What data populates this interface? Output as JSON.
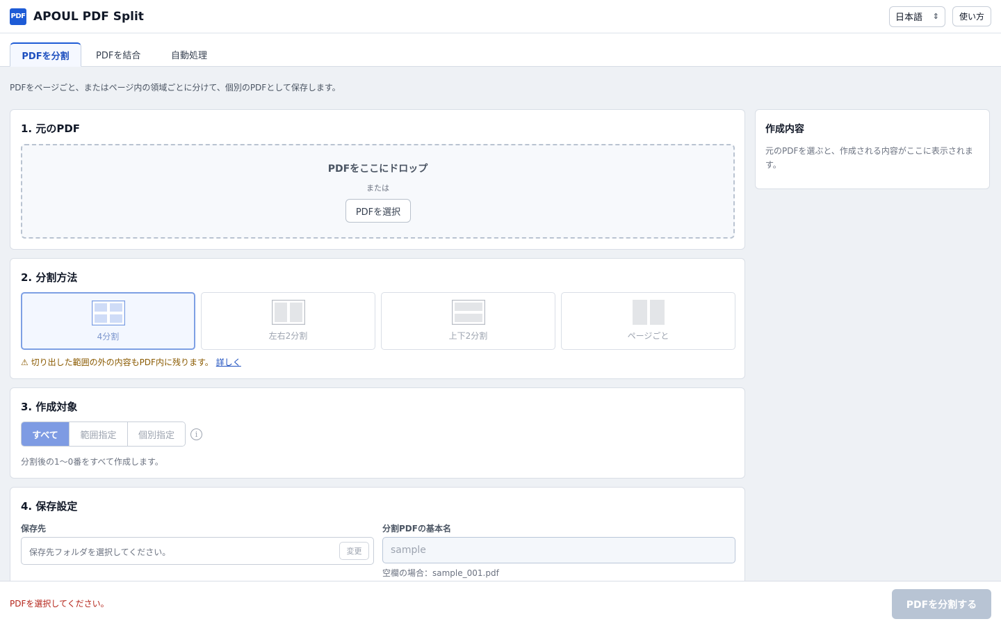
{
  "app": {
    "logo_text": "PDF",
    "title": "APOUL PDF Split",
    "language": "日本語",
    "help_label": "使い方"
  },
  "tabs": [
    {
      "label": "PDFを分割",
      "active": true
    },
    {
      "label": "PDFを結合",
      "active": false
    },
    {
      "label": "自動処理",
      "active": false
    }
  ],
  "description": "PDFをページごと、またはページ内の領域ごとに分けて、個別のPDFとして保存します。",
  "source": {
    "title": "1. 元のPDF",
    "drop_title": "PDFをここにドロップ",
    "or": "または",
    "select_button": "PDFを選択"
  },
  "method": {
    "title": "2. 分割方法",
    "options": [
      {
        "label": "4分割",
        "icon": "quad-split-icon",
        "selected": true
      },
      {
        "label": "左右2分割",
        "icon": "vertical-split-icon",
        "selected": false
      },
      {
        "label": "上下2分割",
        "icon": "horizontal-split-icon",
        "selected": false
      },
      {
        "label": "ページごと",
        "icon": "per-page-icon",
        "selected": false
      }
    ],
    "warning": "⚠ 切り出した範囲の外の内容もPDF内に残ります。",
    "warning_link": "詳しく"
  },
  "target": {
    "title": "3. 作成対象",
    "segments": [
      {
        "label": "すべて",
        "active": true
      },
      {
        "label": "範囲指定",
        "active": false
      },
      {
        "label": "個別指定",
        "active": false
      }
    ],
    "info_icon": "info-icon",
    "note": "分割後の1〜0番をすべて作成します。"
  },
  "save": {
    "title": "4. 保存設定",
    "folder_label": "保存先",
    "folder_placeholder": "保存先フォルダを選択してください。",
    "change_button": "変更",
    "basename_label": "分割PDFの基本名",
    "basename_placeholder": "sample",
    "basename_hint": "空欄の場合：sample_001.pdf"
  },
  "summary": {
    "title": "作成内容",
    "text": "元のPDFを選ぶと、作成される内容がここに表示されます。"
  },
  "footer": {
    "status": "PDFを選択してください。",
    "split_button": "PDFを分割する"
  },
  "colors": {
    "accent": "#1d5bd6",
    "selected_option_border": "#7d9fe4",
    "active_segment": "#7e9be3",
    "error_text": "#b42318",
    "warning_text": "#8a5a00",
    "disabled_button": "#b8c4d4"
  }
}
